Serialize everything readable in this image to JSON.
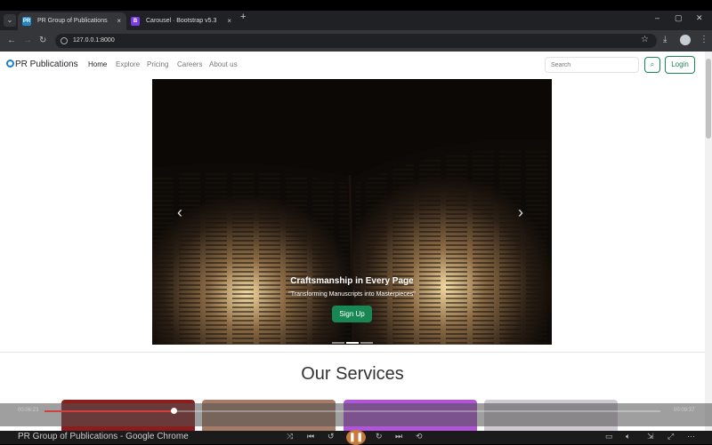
{
  "browser": {
    "tabs": [
      {
        "title": "PR Group of Publications",
        "favicon": "PR",
        "active": true
      },
      {
        "title": "Carousel · Bootstrap v5.3",
        "favicon": "B",
        "active": false
      }
    ],
    "new_tab": "+",
    "close": "×",
    "url": "127.0.0.1:8000",
    "controls": {
      "minimize": "–",
      "restore": "▢",
      "close": "✕"
    }
  },
  "site": {
    "brand": "PR Publications",
    "nav": [
      "Home",
      "Explore",
      "Pricing",
      "Careers",
      "About us"
    ],
    "search_placeholder": "Search",
    "login": "Login"
  },
  "carousel": {
    "heading": "Craftsmanship in Every Page",
    "subheading": "\"Transforming Manuscripts into Masterpieces\"",
    "button": "Sign Up",
    "prev": "‹",
    "next": "›",
    "slides": 3,
    "active_slide": 2
  },
  "services": {
    "title": "Our Services",
    "card_colors": [
      "#8b1d1d",
      "#a67c68",
      "#b054d8",
      "#cfc9d1"
    ]
  },
  "video_overlay": {
    "elapsed": "00:06:23",
    "total": "00:09:37",
    "progress": 0.21
  },
  "taskbar": {
    "window_title": "PR Group of Publications - Google Chrome"
  }
}
